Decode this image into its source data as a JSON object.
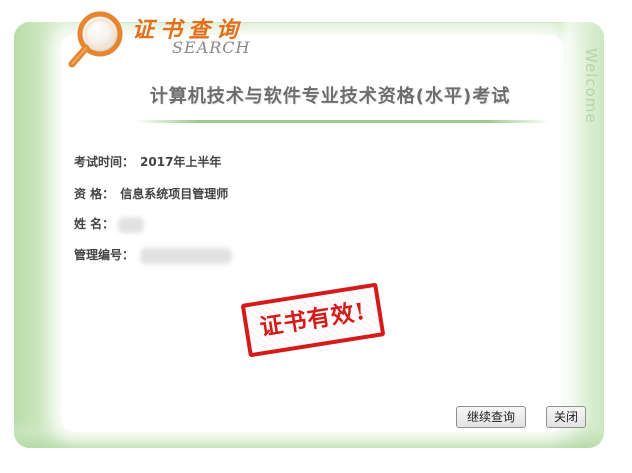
{
  "header": {
    "brand_title": "证书查询",
    "brand_subtitle": "SEARCH",
    "side_label": "Welcome"
  },
  "exam": {
    "title": "计算机技术与软件专业技术资格(水平)考试"
  },
  "fields": [
    {
      "label": "考试时间：",
      "value": "2017年上半年"
    },
    {
      "label": "资 格：",
      "value": "信息系统项目管理师"
    },
    {
      "label": "姓 名：",
      "value": ""
    },
    {
      "label": "管理编号：",
      "value": ""
    }
  ],
  "stamp": {
    "text": "证书有效!"
  },
  "buttons": {
    "continue_label": "继续查询",
    "close_label": "关闭"
  },
  "colors": {
    "frame_green": "#cfe8c4",
    "brand_orange": "#e46f1a",
    "stamp_red": "#d51a1a"
  },
  "icons": [
    "magnifier-icon"
  ]
}
